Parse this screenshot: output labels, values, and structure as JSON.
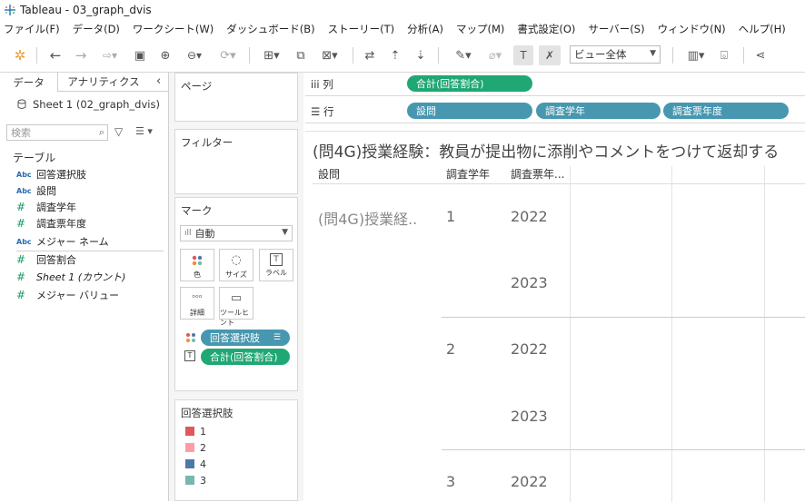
{
  "window": {
    "title": "Tableau - 03_graph_dvis"
  },
  "menu": [
    "ファイル(F)",
    "データ(D)",
    "ワークシート(W)",
    "ダッシュボード(B)",
    "ストーリー(T)",
    "分析(A)",
    "マップ(M)",
    "書式設定(O)",
    "サーバー(S)",
    "ウィンドウ(N)",
    "ヘルプ(H)"
  ],
  "toolbar": {
    "fit_value": "ビュー全体"
  },
  "data_pane": {
    "tabs": [
      "データ",
      "アナリティクス"
    ],
    "source": "Sheet 1 (02_graph_dvis)",
    "search_placeholder": "検索",
    "section": "テーブル",
    "fields": [
      {
        "type": "Abc",
        "name": "回答選択肢"
      },
      {
        "type": "Abc",
        "name": "設問"
      },
      {
        "type": "#",
        "name": "調査学年"
      },
      {
        "type": "#",
        "name": "調査票年度"
      },
      {
        "type": "Abc",
        "name": "メジャー ネーム"
      },
      {
        "type": "#",
        "name": "回答割合"
      },
      {
        "type": "#",
        "name": "Sheet 1 (カウント)"
      },
      {
        "type": "#",
        "name": "メジャー バリュー"
      }
    ]
  },
  "shelves": {
    "pages_label": "ページ",
    "filters_label": "フィルター",
    "marks_label": "マーク",
    "mark_type": "自動",
    "mark_buttons": [
      "色",
      "サイズ",
      "ラベル",
      "詳細",
      "ツールヒント"
    ],
    "mark_pills": [
      "回答選択肢",
      "合計(回答割合)"
    ],
    "columns_label": "列",
    "rows_label": "行",
    "columns_pills": [
      "合計(回答割合)"
    ],
    "rows_pills": [
      "設問",
      "調査学年",
      "調査票年度"
    ]
  },
  "legend": {
    "title": "回答選択肢",
    "items": [
      {
        "label": "1",
        "color": "#e15759"
      },
      {
        "label": "2",
        "color": "#ff9da7"
      },
      {
        "label": "4",
        "color": "#4e79a7"
      },
      {
        "label": "3",
        "color": "#76b7b2"
      }
    ]
  },
  "view": {
    "title": "(問4G)授業経験：教員が提出物に添削やコメントをつけて返却する",
    "headers": [
      "設問",
      "調査学年",
      "調査票年..."
    ],
    "question": "(問4G)授業経..",
    "rows": [
      {
        "grade": "1",
        "years": [
          "2022",
          "2023"
        ]
      },
      {
        "grade": "2",
        "years": [
          "2022",
          "2023"
        ]
      },
      {
        "grade": "3",
        "years": [
          "2022"
        ]
      }
    ]
  }
}
